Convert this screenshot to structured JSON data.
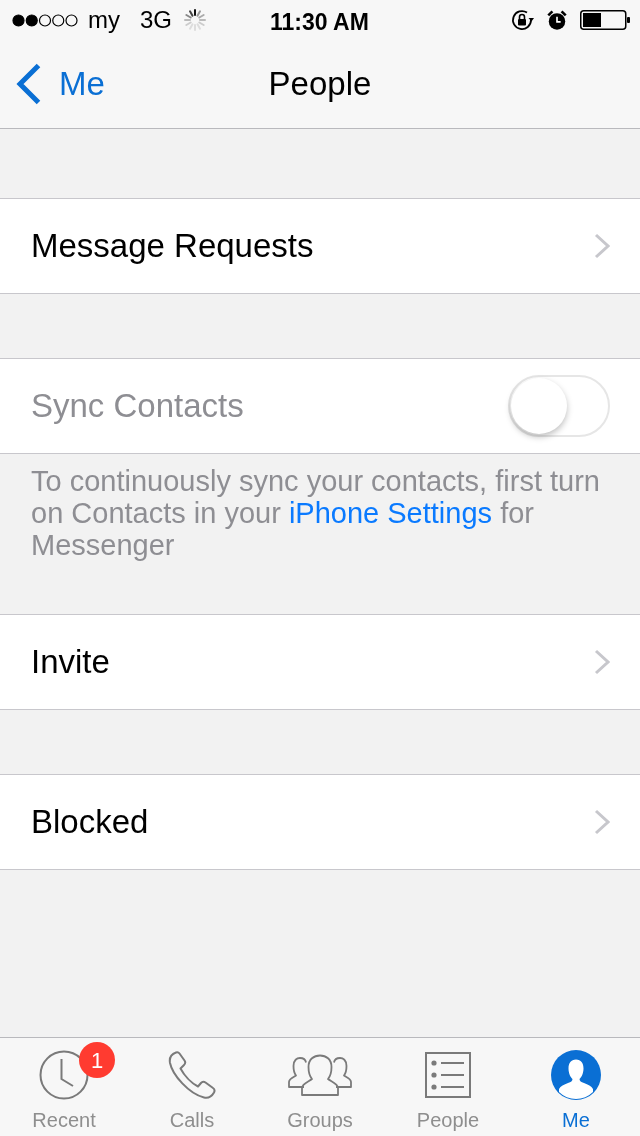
{
  "status_bar": {
    "carrier": "my",
    "network": "3G",
    "time": "11:30 AM"
  },
  "nav_bar": {
    "back_label": "Me",
    "title": "People"
  },
  "sections": [
    {
      "rows": [
        {
          "kind": "link",
          "label": "Message Requests"
        }
      ]
    },
    {
      "rows": [
        {
          "kind": "toggle",
          "label": "Sync Contacts",
          "disabled": true,
          "on": false
        }
      ],
      "footer": [
        {
          "kind": "text",
          "text": "To continuously sync your contacts, first turn on Contacts in your"
        },
        {
          "kind": "link",
          "text": "iPhone Settings"
        },
        {
          "kind": "text",
          "text": "for Messenger"
        }
      ]
    },
    {
      "rows": [
        {
          "kind": "link",
          "label": "Invite"
        }
      ]
    },
    {
      "rows": [
        {
          "kind": "link",
          "label": "Blocked"
        }
      ]
    }
  ],
  "tab_bar": {
    "tabs": [
      {
        "label": "Recent",
        "badge": "1",
        "selected": false
      },
      {
        "label": "Calls",
        "selected": false
      },
      {
        "label": "Groups",
        "selected": false
      },
      {
        "label": "People",
        "selected": false
      },
      {
        "label": "Me",
        "selected": true
      }
    ]
  }
}
